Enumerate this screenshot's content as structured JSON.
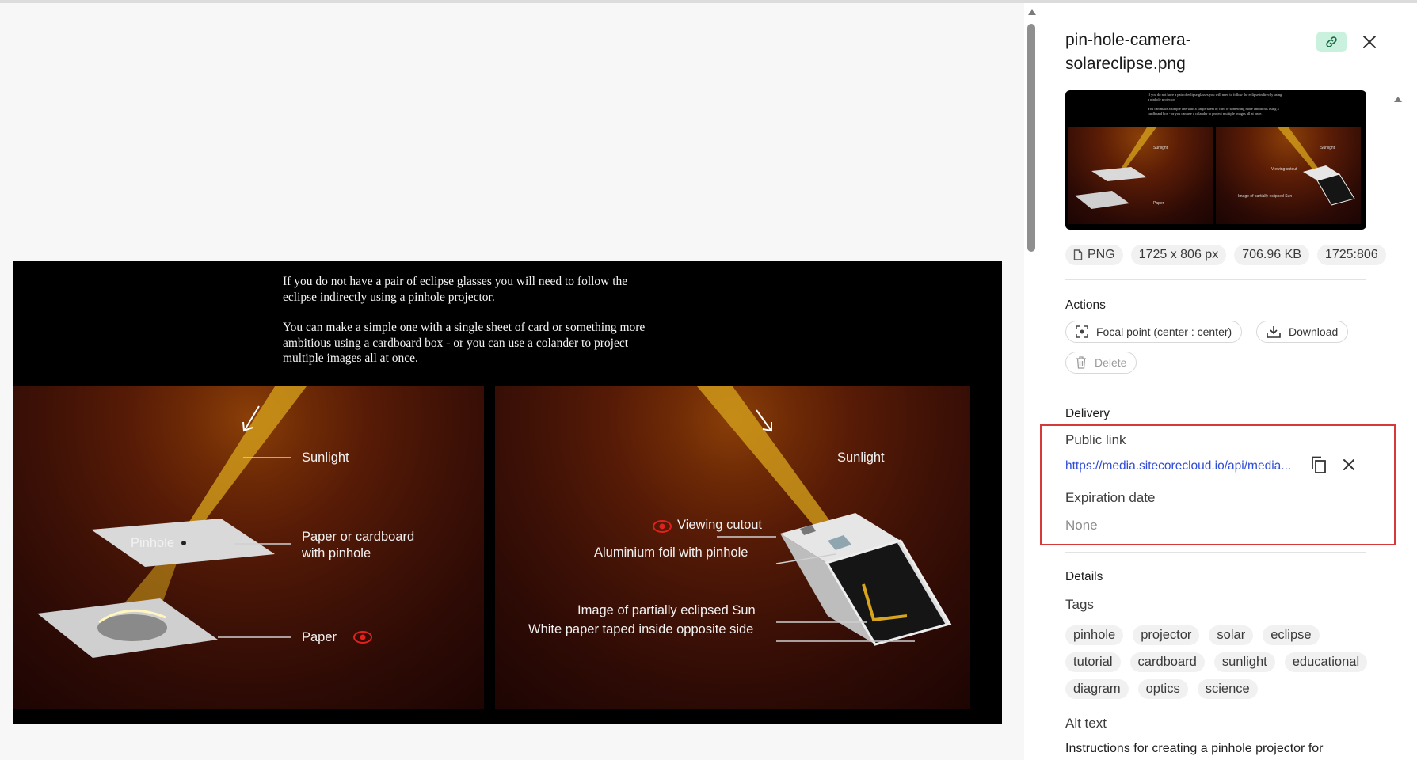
{
  "image": {
    "intro_line1": "If you do not have a pair of eclipse glasses you will need to follow the",
    "intro_line2": "eclipse indirectly using a pinhole projector.",
    "intro_line3": "You can make a simple one with a single sheet of card or something more",
    "intro_line4": "ambitious using a cardboard box - or you can use a colander to project",
    "intro_line5": "multiple images all at once.",
    "left_labels": {
      "sunlight": "Sunlight",
      "pinhole": "Pinhole",
      "paper_card_1": "Paper or cardboard",
      "paper_card_2": "with pinhole",
      "paper": "Paper"
    },
    "right_labels": {
      "sunlight": "Sunlight",
      "viewing_cutout": "Viewing cutout",
      "aluminium": "Aluminium foil with pinhole",
      "image_sun": "Image of partially eclipsed Sun",
      "white_paper": "White paper taped inside opposite side"
    },
    "colors": {
      "sunbeam": "#d9a51c",
      "eye_icon": "#e0211d",
      "panel_dark": "#1d0503"
    }
  },
  "panel": {
    "title": "pin-hole-camera-solareclipse.png",
    "link_icon": "link-icon",
    "close_icon": "close-icon",
    "meta": {
      "format": "PNG",
      "dimensions": "1725 x 806 px",
      "size": "706.96 KB",
      "ratio": "1725:806"
    },
    "actions": {
      "heading": "Actions",
      "focal_point": "Focal point (center : center)",
      "download": "Download",
      "delete": "Delete"
    },
    "delivery": {
      "heading": "Delivery",
      "public_link_label": "Public link",
      "public_link_url": "https://media.sitecorecloud.io/api/media...",
      "expiration_label": "Expiration date",
      "expiration_value": "None"
    },
    "details": {
      "heading": "Details",
      "tags_label": "Tags",
      "tags": [
        "pinhole",
        "projector",
        "solar",
        "eclipse",
        "tutorial",
        "cardboard",
        "sunlight",
        "educational",
        "diagram",
        "optics",
        "science"
      ],
      "alt_label": "Alt text",
      "alt_value": "Instructions for creating a pinhole projector for"
    },
    "colors": {
      "link_chip": "#c9f1dd",
      "link_text": "#2f4cd8",
      "highlight": "#d43a3a"
    }
  }
}
